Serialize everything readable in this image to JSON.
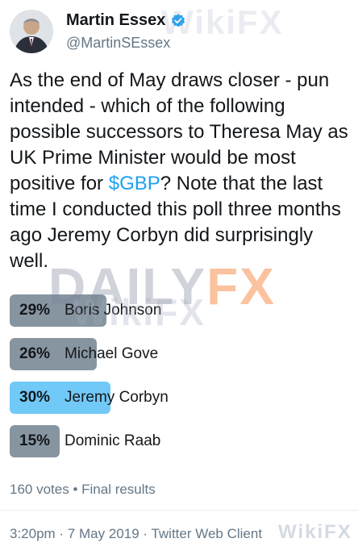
{
  "author": {
    "name": "Martin Essex",
    "handle": "@MartinSEssex",
    "verified_icon": "verified-badge-icon"
  },
  "tweet": {
    "text_before": "As the end of May draws closer - pun intended - which of the following possible successors to Theresa May as UK Prime Minister would be most positive for ",
    "cashtag": "$GBP",
    "text_after": "? Note that the last time I conducted this poll three months ago Jeremy Corbyn did surprisingly well."
  },
  "poll": {
    "options": [
      {
        "percent_label": "29%",
        "label": "Boris Johnson",
        "value": 29,
        "color": "#8795a1"
      },
      {
        "percent_label": "26%",
        "label": "Michael Gove",
        "value": 26,
        "color": "#8795a1"
      },
      {
        "percent_label": "30%",
        "label": "Jeremy Corbyn",
        "value": 30,
        "color": "#71c9f8"
      },
      {
        "percent_label": "15%",
        "label": "Dominic Raab",
        "value": 15,
        "color": "#8795a1"
      }
    ],
    "results_text": "160 votes • Final results"
  },
  "footer": {
    "meta": "3:20pm · 7 May 2019 · Twitter Web Client"
  },
  "watermarks": {
    "wikifx": "WikiFX",
    "daily_a": "DAILY",
    "daily_b": "FX"
  }
}
